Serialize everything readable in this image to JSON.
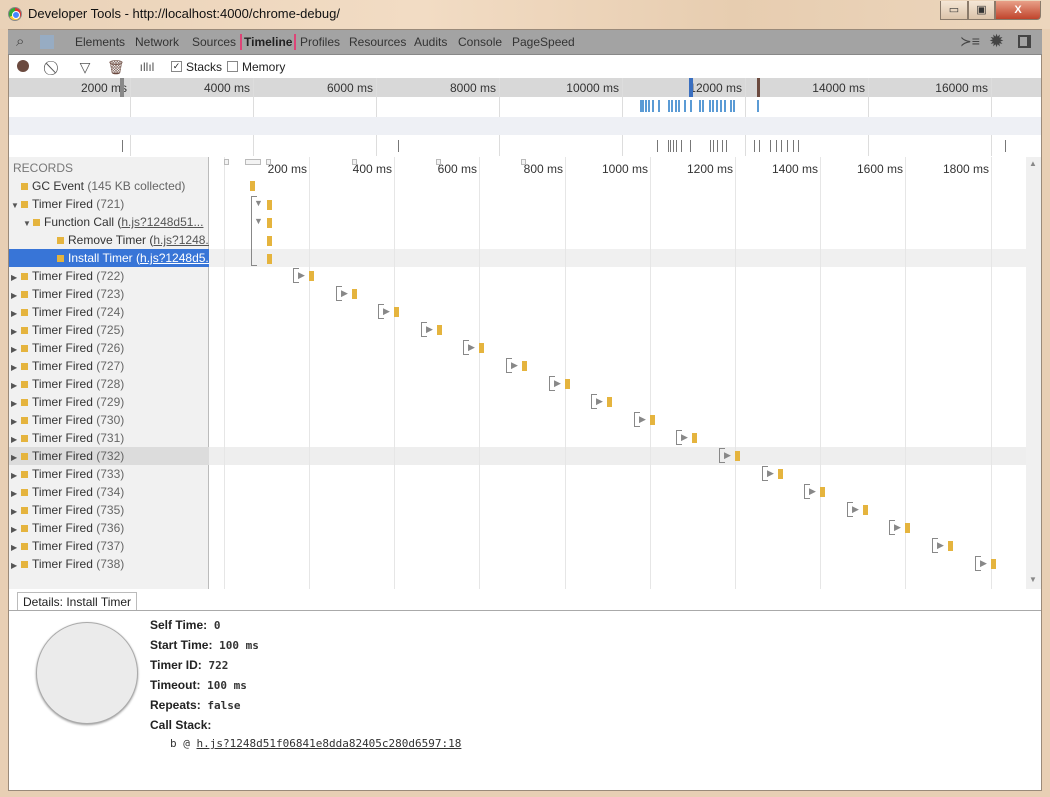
{
  "window": {
    "title": "Developer Tools - http://localhost:4000/chrome-debug/",
    "minimize": "▭",
    "maximize": "▣",
    "close": "X"
  },
  "tabs": [
    {
      "label": "Elements"
    },
    {
      "label": "Network"
    },
    {
      "label": "Sources"
    },
    {
      "label": "Timeline",
      "selected": true
    },
    {
      "label": "Profiles"
    },
    {
      "label": "Resources"
    },
    {
      "label": "Audits"
    },
    {
      "label": "Console"
    },
    {
      "label": "PageSpeed"
    }
  ],
  "toolbar": {
    "stacks_label": "Stacks",
    "stacks_checked": true,
    "memory_label": "Memory",
    "memory_checked": false,
    "check": "✓"
  },
  "overview": {
    "ticks": [
      "2000 ms",
      "4000 ms",
      "6000 ms",
      "8000 ms",
      "10000 ms",
      "12000 ms",
      "14000 ms",
      "16000 ms"
    ]
  },
  "records": {
    "header": "RECORDS",
    "items": [
      {
        "label": "GC Event",
        "extra": "(145 KB collected)",
        "depth": 0
      },
      {
        "label": "Timer Fired",
        "extra": "(721)",
        "depth": 0,
        "toggle": "▼"
      },
      {
        "label": "Function Call",
        "link": "h.js?1248d51...",
        "depth": 1,
        "toggle": "▼"
      },
      {
        "label": "Remove Timer",
        "link": "h.js?1248...",
        "depth": 2
      },
      {
        "label": "Install Timer",
        "link": "h.js?1248d5...",
        "depth": 2,
        "selected": true
      },
      {
        "label": "Timer Fired",
        "extra": "(722)",
        "depth": 0,
        "toggle": "▶"
      },
      {
        "label": "Timer Fired",
        "extra": "(723)",
        "depth": 0,
        "toggle": "▶"
      },
      {
        "label": "Timer Fired",
        "extra": "(724)",
        "depth": 0,
        "toggle": "▶"
      },
      {
        "label": "Timer Fired",
        "extra": "(725)",
        "depth": 0,
        "toggle": "▶"
      },
      {
        "label": "Timer Fired",
        "extra": "(726)",
        "depth": 0,
        "toggle": "▶"
      },
      {
        "label": "Timer Fired",
        "extra": "(727)",
        "depth": 0,
        "toggle": "▶"
      },
      {
        "label": "Timer Fired",
        "extra": "(728)",
        "depth": 0,
        "toggle": "▶"
      },
      {
        "label": "Timer Fired",
        "extra": "(729)",
        "depth": 0,
        "toggle": "▶"
      },
      {
        "label": "Timer Fired",
        "extra": "(730)",
        "depth": 0,
        "toggle": "▶"
      },
      {
        "label": "Timer Fired",
        "extra": "(731)",
        "depth": 0,
        "toggle": "▶"
      },
      {
        "label": "Timer Fired",
        "extra": "(732)",
        "depth": 0,
        "toggle": "▶",
        "highlight": true
      },
      {
        "label": "Timer Fired",
        "extra": "(733)",
        "depth": 0,
        "toggle": "▶"
      },
      {
        "label": "Timer Fired",
        "extra": "(734)",
        "depth": 0,
        "toggle": "▶"
      },
      {
        "label": "Timer Fired",
        "extra": "(735)",
        "depth": 0,
        "toggle": "▶"
      },
      {
        "label": "Timer Fired",
        "extra": "(736)",
        "depth": 0,
        "toggle": "▶"
      },
      {
        "label": "Timer Fired",
        "extra": "(737)",
        "depth": 0,
        "toggle": "▶"
      },
      {
        "label": "Timer Fired",
        "extra": "(738)",
        "depth": 0,
        "toggle": "▶"
      }
    ]
  },
  "timeline": {
    "ticks": [
      "200 ms",
      "400 ms",
      "600 ms",
      "800 ms",
      "1000 ms",
      "1200 ms",
      "1400 ms",
      "1600 ms",
      "1800 ms"
    ],
    "record_color": "#e5b43e",
    "loading_color": "#5b9bd5"
  },
  "details": {
    "tab_label": "Details: Install Timer",
    "fields": [
      {
        "key": "Self Time:",
        "value": "0"
      },
      {
        "key": "Start Time:",
        "value": "100 ms"
      },
      {
        "key": "Timer ID:",
        "value": "722"
      },
      {
        "key": "Timeout:",
        "value": "100 ms"
      },
      {
        "key": "Repeats:",
        "value": "false"
      },
      {
        "key": "Call Stack:",
        "value": ""
      }
    ],
    "stack_prefix": "b @ ",
    "stack_link": "h.js?1248d51f06841e8dda82405c280d6597:18"
  }
}
